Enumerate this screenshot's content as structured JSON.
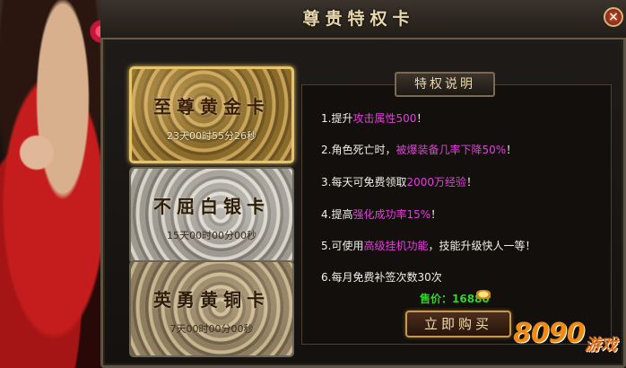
{
  "window": {
    "title": "尊贵特权卡",
    "close_glyph": "×"
  },
  "cards": [
    {
      "name": "至尊黄金卡",
      "time": "23天00时55分26秒",
      "selected": true
    },
    {
      "name": "不屈白银卡",
      "time": "15天00时00分00秒",
      "selected": false
    },
    {
      "name": "英勇黄铜卡",
      "time": "7天00时00分00秒",
      "selected": false
    }
  ],
  "panel": {
    "header": "特权说明",
    "perks": [
      {
        "a": "1.提升",
        "b": "攻击属性500",
        "c": "！"
      },
      {
        "a": "2.角色死亡时，",
        "b": "被爆装备几率下降50%",
        "c": "！"
      },
      {
        "a": "3.每天可免费领取",
        "b": "2000万经验",
        "c": "！"
      },
      {
        "a": "4.提高",
        "b": "强化成功率15%",
        "c": "！"
      },
      {
        "a": "5.可使用",
        "b": "高级挂机功能",
        "c": "，技能升级快人一等！"
      },
      {
        "a": "6.每月免费补签次数30次",
        "b": "",
        "c": ""
      }
    ],
    "price_label": "售价：",
    "price_value": "16880",
    "buy_button": "立即购买"
  },
  "watermark": {
    "digits": "8090",
    "text": "游戏"
  },
  "icons": {
    "close": "close-icon",
    "currency": "gold-ingot-icon",
    "flower": "flower-icon"
  },
  "colors": {
    "highlight": "#e040d8",
    "price": "#32d32a",
    "gold_border": "#e7c469",
    "title_text": "#e9d7ac"
  }
}
